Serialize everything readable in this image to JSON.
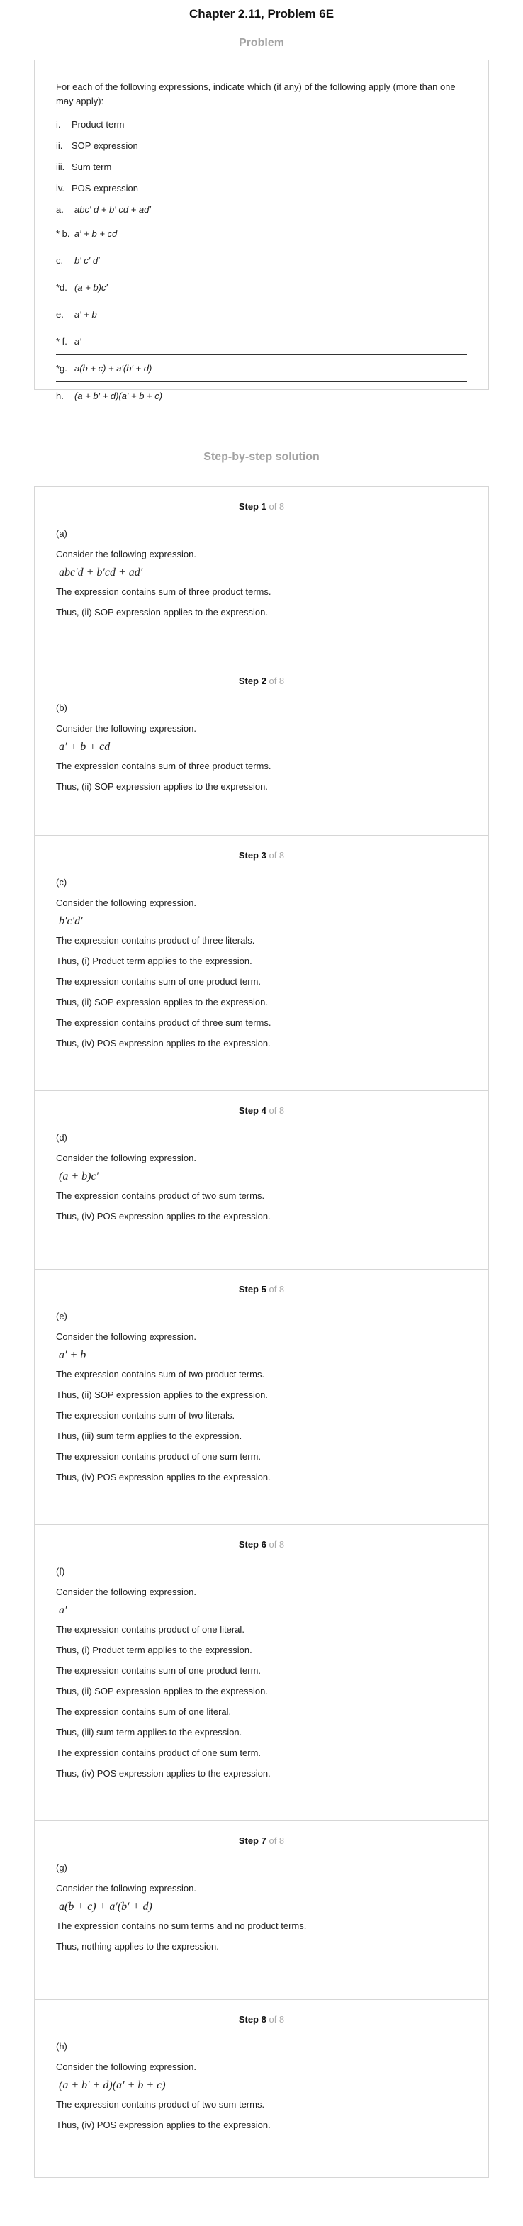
{
  "title": "Chapter 2.11, Problem 6E",
  "problem_heading": "Problem",
  "problem": {
    "intro": "For each of the following expressions, indicate which (if any) of the following apply (more than one may apply):",
    "options": [
      {
        "num": "i.",
        "text": "Product term"
      },
      {
        "num": "ii.",
        "text": "SOP expression"
      },
      {
        "num": "iii.",
        "text": "Sum term"
      },
      {
        "num": "iv.",
        "text": "POS expression"
      }
    ],
    "items": [
      {
        "label": "a.",
        "expr": "abc′ d + b′ cd + ad′"
      },
      {
        "label": "* b.",
        "expr": "a′ + b + cd"
      },
      {
        "label": "c.",
        "expr": "b′ c′ d′"
      },
      {
        "label": "*d.",
        "expr": "(a + b)c′"
      },
      {
        "label": "e.",
        "expr": "a′ + b"
      },
      {
        "label": "* f.",
        "expr": "a′"
      },
      {
        "label": "*g.",
        "expr": "a(b + c) + a′(b′ + d)"
      },
      {
        "label": "h.",
        "expr": "(a + b′ + d)(a′ + b + c)"
      }
    ]
  },
  "solution_heading": "Step-by-step solution",
  "steps": [
    {
      "step_word": "Step 1",
      "of_text": "of 8",
      "part": "(a)",
      "consider": "Consider the following expression.",
      "expr": "abc′d + b′cd + ad′",
      "lines": [
        "The expression contains sum of three product terms.",
        "Thus, (ii) SOP expression applies to the expression."
      ]
    },
    {
      "step_word": "Step 2",
      "of_text": "of 8",
      "part": "(b)",
      "consider": "Consider the following expression.",
      "expr": "a′ + b + cd",
      "lines": [
        "The expression contains sum of three product terms.",
        "Thus, (ii) SOP expression applies to the expression."
      ]
    },
    {
      "step_word": "Step 3",
      "of_text": "of 8",
      "part": "(c)",
      "consider": "Consider the following expression.",
      "expr": "b′c′d′",
      "lines": [
        "The expression contains product of three literals.",
        "Thus, (i) Product term applies to the expression.",
        "The expression contains sum of one product term.",
        "Thus, (ii) SOP expression applies to the expression.",
        "The expression contains product of three sum terms.",
        "Thus, (iv) POS expression applies to the expression."
      ]
    },
    {
      "step_word": "Step 4",
      "of_text": "of 8",
      "part": "(d)",
      "consider": "Consider the following expression.",
      "expr": "(a + b)c′",
      "lines": [
        "The expression contains product of two sum terms.",
        "Thus, (iv) POS expression applies to the expression."
      ]
    },
    {
      "step_word": "Step 5",
      "of_text": "of 8",
      "part": "(e)",
      "consider": "Consider the following expression.",
      "expr": "a′ + b",
      "lines": [
        "The expression contains sum of two product terms.",
        "Thus, (ii) SOP expression applies to the expression.",
        "The expression contains sum of two literals.",
        "Thus, (iii) sum term applies to the expression.",
        "The expression contains product of one sum term.",
        "Thus, (iv) POS expression applies to the expression."
      ]
    },
    {
      "step_word": "Step 6",
      "of_text": "of 8",
      "part": "(f)",
      "consider": "Consider the following expression.",
      "expr": "a′",
      "lines": [
        "The expression contains product of one literal.",
        "Thus, (i) Product term applies to the expression.",
        "The expression contains sum of one product term.",
        "Thus, (ii) SOP expression applies to the expression.",
        "The expression contains sum of one literal.",
        "Thus, (iii) sum term applies to the expression.",
        "The expression contains product of one sum term.",
        "Thus, (iv) POS expression applies to the expression."
      ]
    },
    {
      "step_word": "Step 7",
      "of_text": "of 8",
      "part": "(g)",
      "consider": "Consider the following expression.",
      "expr": "a(b + c) + a′(b′ + d)",
      "lines": [
        "The expression contains no sum terms and no product terms.",
        "Thus, nothing applies to the expression."
      ]
    },
    {
      "step_word": "Step 8",
      "of_text": "of 8",
      "part": "(h)",
      "consider": "Consider the following expression.",
      "expr": "(a + b′ + d)(a′ + b + c)",
      "lines": [
        "The expression contains product of two sum terms.",
        "Thus, (iv) POS expression applies to the expression."
      ]
    }
  ]
}
